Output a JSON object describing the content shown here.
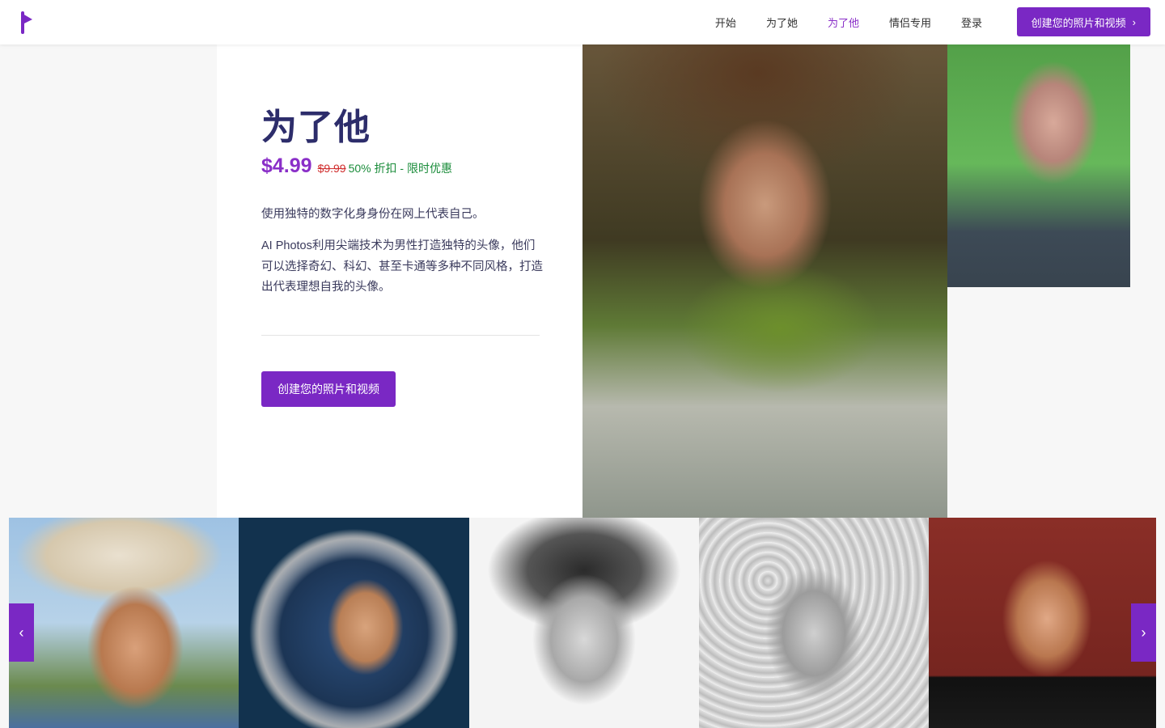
{
  "header": {
    "nav": [
      {
        "label": "开始"
      },
      {
        "label": "为了她"
      },
      {
        "label": "为了他"
      },
      {
        "label": "情侣专用"
      },
      {
        "label": "登录"
      }
    ],
    "active_nav": "为了他",
    "cta_label": "创建您的照片和视频",
    "cta_icon": "chevron-right-icon"
  },
  "product": {
    "title": "为了他",
    "price_now": "$4.99",
    "price_old": "$9.99",
    "discount": "50% 折扣 - 限时优惠",
    "description_1": "使用独特的数字化身身份在网上代表自己。",
    "description_2": "AI Photos利用尖端技术为男性打造独特的头像，他们可以选择奇幻、科幻、甚至卡通等多种不同风格，打造出代表理想自我的头像。",
    "cta_label": "创建您的照片和视频"
  },
  "colors": {
    "accent": "#7a28c4",
    "active_nav": "#8a2fc8",
    "title": "#2d2d6b",
    "old_price": "#d02e2e",
    "discount": "#1a8c3a"
  },
  "gallery": {
    "prev_icon": "chevron-left-icon",
    "next_icon": "chevron-right-icon",
    "items": [
      {
        "subject": "cowboy-portrait"
      },
      {
        "subject": "astronaut-portrait"
      },
      {
        "subject": "pencil-sketch-portrait"
      },
      {
        "subject": "floral-sketch-portrait"
      },
      {
        "subject": "tuxedo-portrait"
      }
    ]
  },
  "arrows": {
    "prev": "‹",
    "next": "›",
    "cta_chevron": "›"
  }
}
